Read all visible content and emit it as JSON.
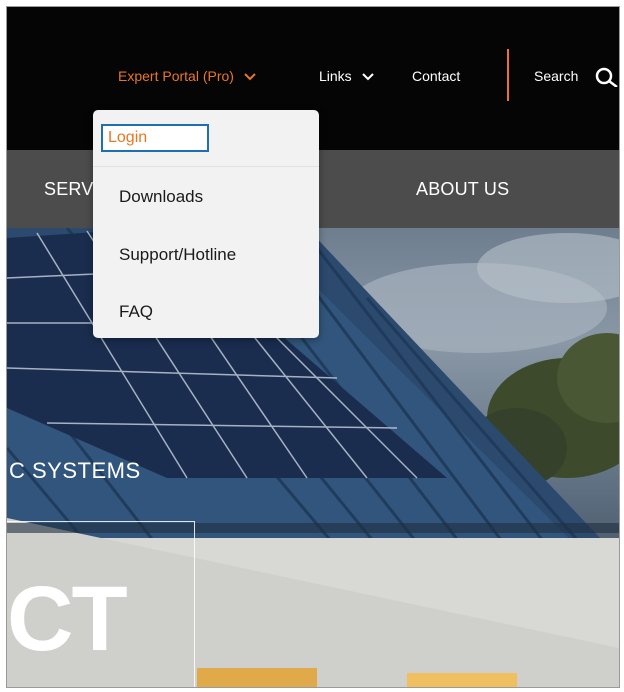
{
  "topbar": {
    "expert_portal": "Expert Portal (Pro)",
    "links": "Links",
    "contact": "Contact",
    "search": "Search"
  },
  "nav": {
    "services": "SERV",
    "about": "ABOUT US"
  },
  "dropdown": {
    "items": [
      "Login",
      "Downloads",
      "Support/Hotline",
      "FAQ"
    ]
  },
  "hero": {
    "caption": "C SYSTEMS",
    "big_text": "CT"
  },
  "colors": {
    "accent": "#e87722",
    "focus": "#1f6fb5",
    "nav_bg": "#4c4c4c",
    "top_bg": "#050505"
  },
  "icons": [
    "chevron-down-icon",
    "search-icon"
  ]
}
